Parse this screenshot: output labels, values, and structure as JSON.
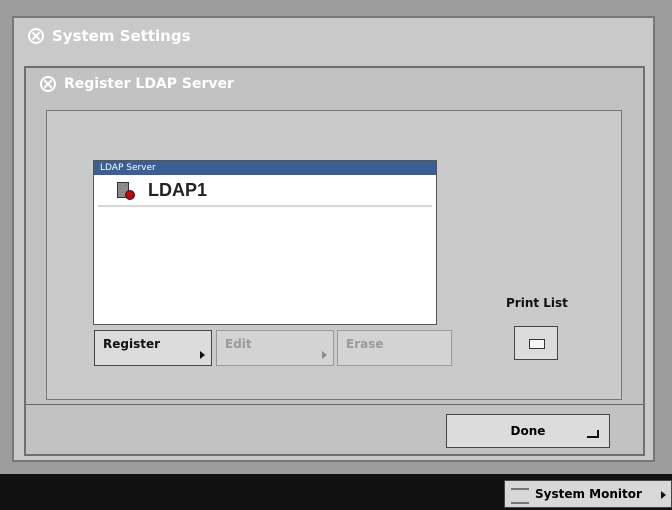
{
  "outer_panel": {
    "title": "System Settings",
    "icon": "gear-icon"
  },
  "inner_panel": {
    "title": "Register LDAP Server",
    "icon": "gear-icon"
  },
  "list": {
    "header": "LDAP Server",
    "items": [
      {
        "label": "LDAP1",
        "icon": "ldap-server-icon"
      }
    ]
  },
  "buttons": {
    "register": "Register",
    "edit": "Edit",
    "erase": "Erase",
    "print_list_label": "Print List",
    "done": "Done"
  },
  "status_bar": {
    "system_monitor": "System Monitor"
  }
}
